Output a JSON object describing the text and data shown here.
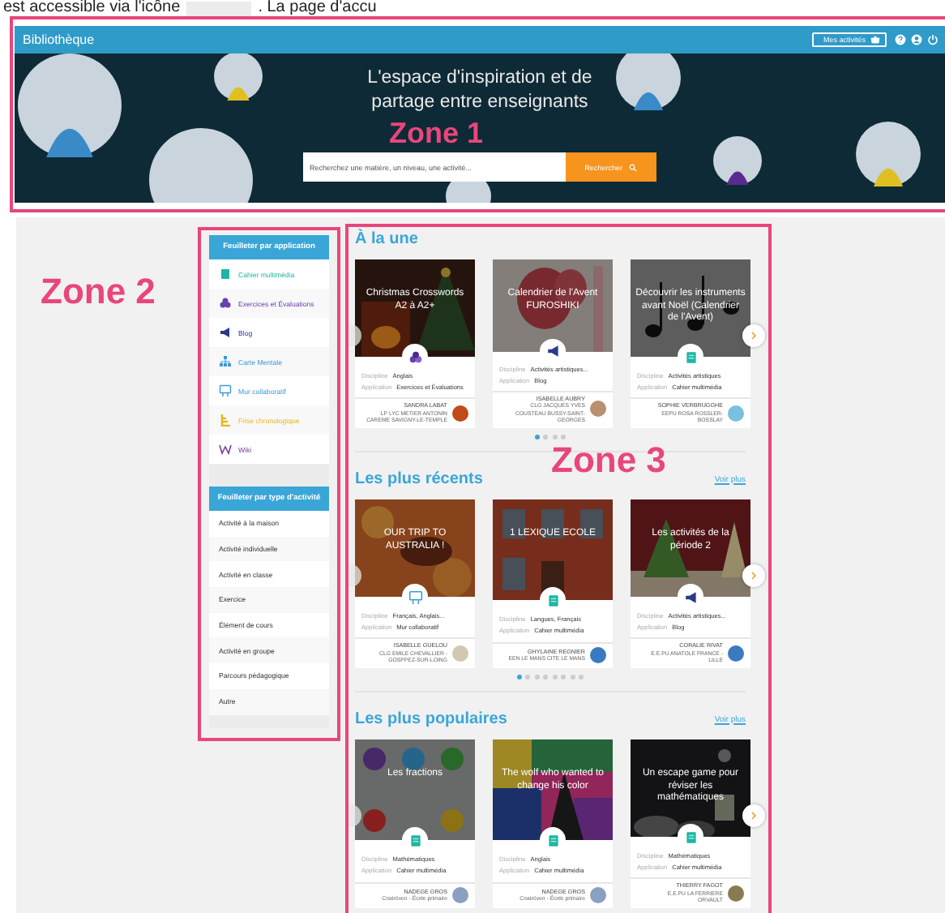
{
  "doc_text": {
    "before": "est accessible via l'icône",
    "after": ". La page d'accu"
  },
  "header": {
    "logo": "Bibliothèque",
    "activities_button": "Mes activités"
  },
  "hero": {
    "title": "L'espace d'inspiration et de partage entre enseignants",
    "search": {
      "placeholder": "Recherchez une matière, un niveau, une activité..."
    },
    "search_button": "Rechercher"
  },
  "sidebar": {
    "sections": [
      {
        "title": "Feuilleter par application",
        "items": [
          {
            "label": "Cahier multimédia",
            "kind": "cahier",
            "color": "#1fb5a3"
          },
          {
            "label": "Exercices et Évaluations",
            "kind": "exercices",
            "color": "#6a3fb0"
          },
          {
            "label": "Blog",
            "kind": "blog",
            "color": "#2a3a8a"
          },
          {
            "label": "Carte Mentale",
            "kind": "carte",
            "color": "#3a9ad8"
          },
          {
            "label": "Mur collaboratif",
            "kind": "mur",
            "color": "#3a9ad8"
          },
          {
            "label": "Frise chronologique",
            "kind": "frise",
            "color": "#e8b820"
          },
          {
            "label": "Wiki",
            "kind": "wiki",
            "color": "#7a3a9a"
          }
        ]
      },
      {
        "title": "Feuilleter par type d'activité",
        "items": [
          {
            "label": "Activité à la maison"
          },
          {
            "label": "Activité individuelle"
          },
          {
            "label": "Activité en classe"
          },
          {
            "label": "Exercice"
          },
          {
            "label": "Élément de cours"
          },
          {
            "label": "Activité en groupe"
          },
          {
            "label": "Parcours pédagogique"
          },
          {
            "label": "Autre"
          }
        ]
      }
    ]
  },
  "sections": [
    {
      "title": "À la une",
      "cards": [
        {
          "title": "Christmas Crosswords A2 à A2+",
          "app_icon": {
            "kind": "exercices"
          },
          "fields": [
            {
              "label": "Discipline",
              "value": "Anglais"
            },
            {
              "label": "Application",
              "value": "Exercices et Évaluations"
            }
          ],
          "author": "SANDRA LABAT",
          "school": "LP LYC METIER ANTONIN CAREME SAVIGNY-LE-TEMPLE"
        },
        {
          "title": "Calendrier de l'Avent FUROSHIKI",
          "app_icon": {
            "kind": "blog"
          },
          "fields": [
            {
              "label": "Discipline",
              "value": "Activités artistiques..."
            },
            {
              "label": "Application",
              "value": "Blog"
            }
          ],
          "author": "ISABELLE AUBRY",
          "school": "CLG JACQUES YVES COUSTEAU BUSSY-SAINT-GEORGES"
        },
        {
          "title": "Découvrir les instruments avant Noël (Calendrier de l'Avent)",
          "app_icon": {
            "kind": "cahier"
          },
          "fields": [
            {
              "label": "Discipline",
              "value": "Activités artistiques"
            },
            {
              "label": "Application",
              "value": "Cahier multimédia"
            }
          ],
          "author": "SOPHIE VERBRUGGHE",
          "school": "EEPU ROSA ROSSLER-BOSSLAY"
        }
      ],
      "dots": [
        {
          "selected": true
        },
        {
          "selected": false
        },
        {
          "selected": false
        },
        {
          "selected": false
        }
      ]
    },
    {
      "title": "Les plus récents",
      "more_link": "Voir plus",
      "cards": [
        {
          "title": "OUR TRIP TO AUSTRALIA !",
          "app_icon": {
            "kind": "mur"
          },
          "fields": [
            {
              "label": "Discipline",
              "value": "Français, Anglais..."
            },
            {
              "label": "Application",
              "value": "Mur collaboratif"
            }
          ],
          "author": "ISABELLE GUELOU",
          "school": "CLG EMILE CHEVALLIER - GOSPPEZ-SUR-LOING"
        },
        {
          "title": "1 LEXIQUE ECOLE",
          "app_icon": {
            "kind": "cahier"
          },
          "fields": [
            {
              "label": "Discipline",
              "value": "Langues, Français"
            },
            {
              "label": "Application",
              "value": "Cahier multimédia"
            }
          ],
          "author": "GHYLAINE REGNIER",
          "school": "EEN LE MANS CITE LE MANS"
        },
        {
          "title": "Les activités de la période 2",
          "app_icon": {
            "kind": "blog"
          },
          "fields": [
            {
              "label": "Discipline",
              "value": "Activités artistiques..."
            },
            {
              "label": "Application",
              "value": "Blog"
            }
          ],
          "author": "CORALIE RIVAT",
          "school": "E.E.PU ANATOLE FRANCE - LILLE"
        }
      ],
      "dots": [
        {
          "selected": true
        },
        {
          "selected": false
        },
        {
          "selected": false
        },
        {
          "selected": false
        },
        {
          "selected": false
        },
        {
          "selected": false
        },
        {
          "selected": false
        },
        {
          "selected": false
        }
      ]
    },
    {
      "title": "Les plus populaires",
      "more_link": "Voir plus",
      "cards": [
        {
          "title": "Les fractions",
          "app_icon": {
            "kind": "cahier"
          },
          "fields": [
            {
              "label": "Discipline",
              "value": "Mathématiques"
            },
            {
              "label": "Application",
              "value": "Cahier multimédia"
            }
          ],
          "author": "NADEGE GROS",
          "school": "Coatréven - École primaire"
        },
        {
          "title": "The wolf who wanted to change his color",
          "app_icon": {
            "kind": "cahier"
          },
          "fields": [
            {
              "label": "Discipline",
              "value": "Anglais"
            },
            {
              "label": "Application",
              "value": "Cahier multimédia"
            }
          ],
          "author": "NADEGE GROS",
          "school": "Coatréven - École primaire"
        },
        {
          "title": "Un escape game pour réviser les mathématiques",
          "app_icon": {
            "kind": "cahier"
          },
          "fields": [
            {
              "label": "Discipline",
              "value": "Mathématiques"
            },
            {
              "label": "Application",
              "value": "Cahier multimédia"
            }
          ],
          "author": "THIERRY FAGOT",
          "school": "E.E.PU LA FERRIERE ORVAULT"
        }
      ]
    }
  ],
  "annotations": [
    {
      "label": "Zone 1"
    },
    {
      "label": "Zone 2"
    },
    {
      "label": "Zone 3"
    }
  ]
}
